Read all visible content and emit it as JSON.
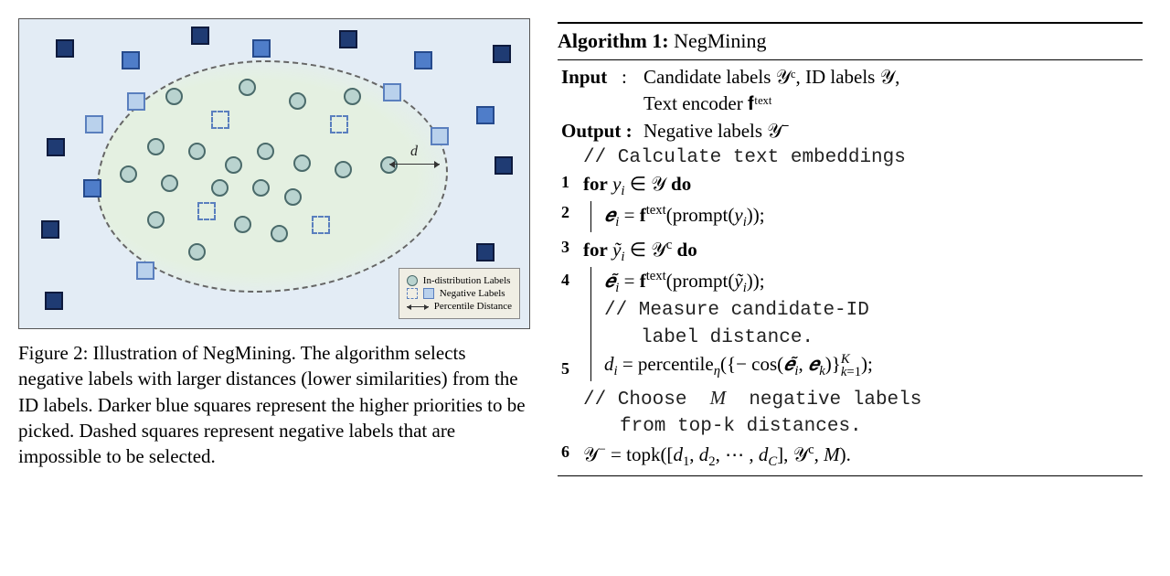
{
  "figure": {
    "legend": {
      "in_dist": "In-distribution Labels",
      "negative": "Negative Labels",
      "percentile": "Percentile Distance"
    },
    "d_label": "d",
    "caption": "Figure 2: Illustration of NegMining. The algorithm selects negative labels with larger distances (lower similarities) from the ID labels. Darker blue squares represent the higher priorities to be picked. Dashed squares represent negative labels that are impossible to be selected."
  },
  "algorithm": {
    "title_label": "Algorithm 1:",
    "title_name": "NegMining",
    "input_label": "Input",
    "input_text_a": "Candidate labels 𝒴ᶜ, ID labels 𝒴,",
    "input_text_b": "Text encoder 𝐟ᵗᵉˣᵗ",
    "output_label": "Output :",
    "output_text": "Negative labels 𝒴⁻",
    "comment1": "// Calculate text embeddings",
    "line1": "for yᵢ ∈ 𝒴 do",
    "line2": "𝒆ᵢ = 𝐟ᵗᵉˣᵗ(prompt(yᵢ));",
    "line3": "for ỹᵢ ∈ 𝒴ᶜ do",
    "line4": "𝒆̃ᵢ = 𝐟ᵗᵉˣᵗ(prompt(ỹᵢ));",
    "comment2a": "// Measure candidate-ID",
    "comment2b": "label distance.",
    "line5_a": "dᵢ = percentile",
    "line5_eta": "η",
    "line5_b": "({− cos(𝒆̃ᵢ, 𝒆ₖ)}",
    "line5_sup": "K",
    "line5_sub": "k=1",
    "line5_c": ");",
    "comment3a": "// Choose M negative labels",
    "comment3b": "from top-k distances.",
    "line6": "𝒴⁻ = topk([d₁, d₂, ⋯ , d_C], 𝒴ᶜ, M)."
  }
}
